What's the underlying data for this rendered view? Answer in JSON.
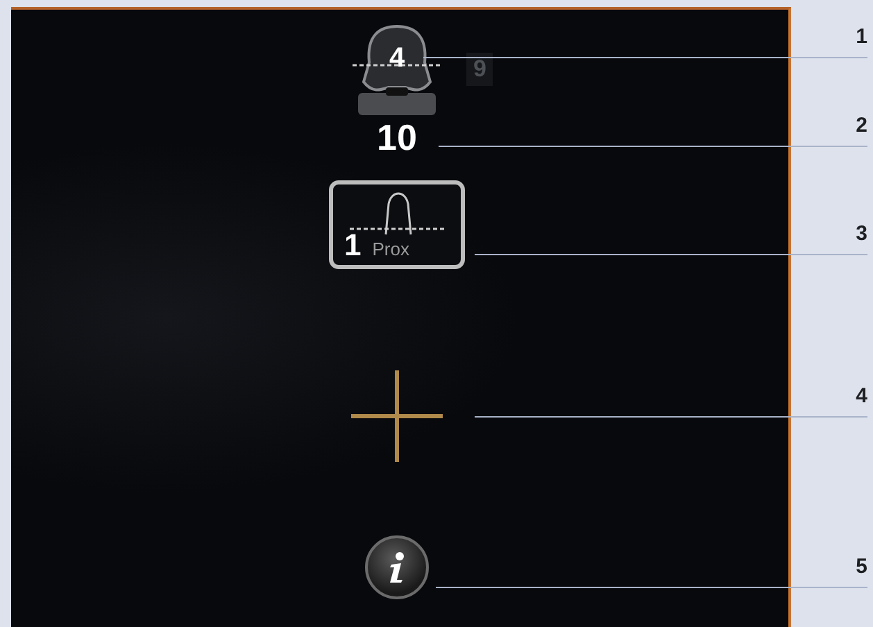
{
  "screen": {
    "implant_size": "4",
    "alternate_size": "9",
    "insert_thickness": "10",
    "resection_level": "1",
    "resection_side": "Prox"
  },
  "callouts": [
    {
      "number": "1"
    },
    {
      "number": "2"
    },
    {
      "number": "3"
    },
    {
      "number": "4"
    },
    {
      "number": "5"
    }
  ]
}
